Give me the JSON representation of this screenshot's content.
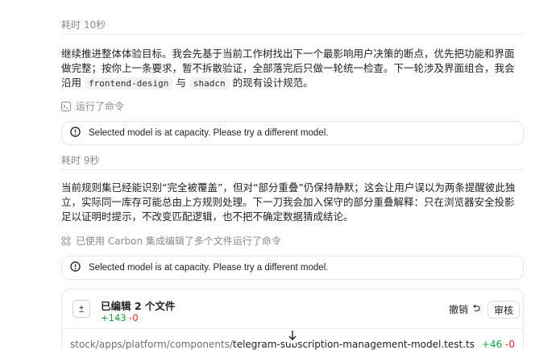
{
  "blocks": [
    {
      "elapsed": "耗时 10秒",
      "paragraph": {
        "part1": "继续推进整体体验目标。我会先基于当前工作树找出下一个最影响用户决策的断点，优先把功能和界面做完整；按你上一条要求，暂不拆散验证，全部落完后只做一轮统一检查。下一轮涉及界面组合，我会沿用",
        "code1": "frontend-design",
        "part2": "与",
        "code2": "shadcn",
        "part3": "的现有设计规范。"
      },
      "command": "运行了命令",
      "alert": "Selected model is at capacity. Please try a different model."
    },
    {
      "elapsed": "耗时 9秒",
      "paragraph": {
        "text": "当前规则集已经能识别“完全被覆盖”，但对“部分重叠”仍保持静默；这会让用户误以为两条提醒彼此独立，实际同一库存可能总由上方规则处理。下一刀我会加入保守的部分重叠解释：只在浏览器安全投影足以证明时提示，不改变匹配逻辑，也不把不确定数据猜成结论。"
      },
      "command": "已使用 Carbon 集成编辑了多个文件运行了命令",
      "alert": "Selected model is at capacity. Please try a different model."
    }
  ],
  "edit_card": {
    "title": "已编辑 2 个文件",
    "additions": "+143",
    "deletions": "-0",
    "undo_label": "撤销",
    "review_label": "审核",
    "files": [
      {
        "path_prefix": "stock/apps/platform/components/",
        "file_name": "telegram-subscription-management-model.test.ts",
        "additions": "+46",
        "deletions": "-0"
      }
    ]
  },
  "colors": {
    "addition": "#1a9e3f",
    "deletion": "#d93025",
    "muted": "#8a8a8a"
  },
  "icons": {
    "terminal": "terminal-icon",
    "multi_tool": "grid-tool-icon",
    "alert": "alert-circle-icon",
    "file": "file-diff-icon",
    "undo": "undo-icon",
    "scroll": "arrow-down-icon"
  }
}
